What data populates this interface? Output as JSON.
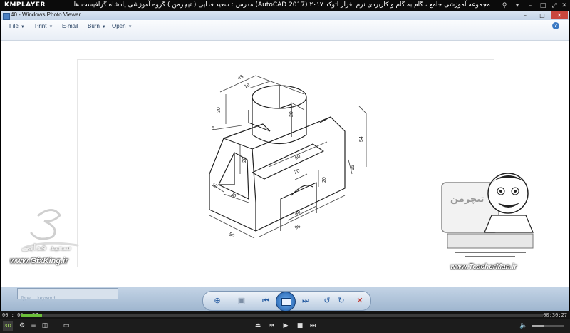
{
  "kmplayer": {
    "logo": "KMPLAYER",
    "caption": "مجموعه آموزشی جامع ، گام به گام و کاربردی نرم افزار  اتوکد ۲۰۱۷ (AutoCAD 2017)  مدرس : سعید فدایی ( تیچرمن ) گروه آموزشی پادشاه گرافیست ها",
    "time_elapsed": "00 : 00 : 27",
    "time_total": "00:30:27",
    "progress_fraction": 0.04,
    "volume_fraction": 0.4,
    "badge_3d": "3D"
  },
  "wpv": {
    "title": "40 - Windows Photo Viewer",
    "menu": [
      {
        "label": "File"
      },
      {
        "label": "Print"
      },
      {
        "label": "E-mail"
      },
      {
        "label": "Burn"
      },
      {
        "label": "Open"
      }
    ],
    "help": "?",
    "bottom_field_placeholder": "Type ... keyword"
  },
  "drawing_dims": {
    "d45": "45",
    "d16": "16",
    "d30": "30",
    "d20_top": "20",
    "d5": "5",
    "d54": "54",
    "d60": "60",
    "d28": "28",
    "d15": "15",
    "d20_mid": "20",
    "d20_side": "20",
    "d10": "10",
    "d30_low": "30",
    "d40": "40",
    "d96": "96",
    "d50": "50"
  },
  "watermarks": {
    "left_site": "www.GfxKing.ir",
    "right_site": "www.TeacherMan.ir",
    "left_name": "سعید فدایی",
    "badge_text": "تیچرمن"
  }
}
